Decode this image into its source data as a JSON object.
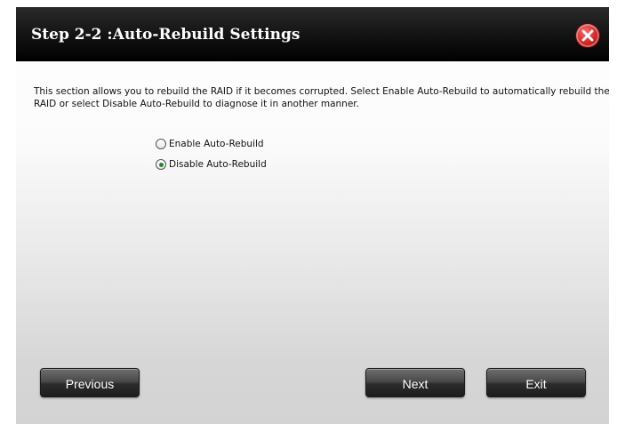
{
  "dialog": {
    "title": "Step 2-2 :Auto-Rebuild Settings",
    "description": "This section allows you to rebuild the RAID if it becomes corrupted. Select Enable Auto-Rebuild to automatically rebuild the RAID or select Disable Auto-Rebuild to diagnose it in another manner.",
    "close_icon": "close-icon",
    "options": [
      {
        "label": "Enable Auto-Rebuild",
        "selected": false
      },
      {
        "label": "Disable Auto-Rebuild",
        "selected": true
      }
    ],
    "buttons": {
      "previous": "Previous",
      "next": "Next",
      "exit": "Exit"
    },
    "colors": {
      "titlebar": "#000000",
      "close": "#d42323",
      "radio_selected": "#1c8a2a"
    }
  }
}
